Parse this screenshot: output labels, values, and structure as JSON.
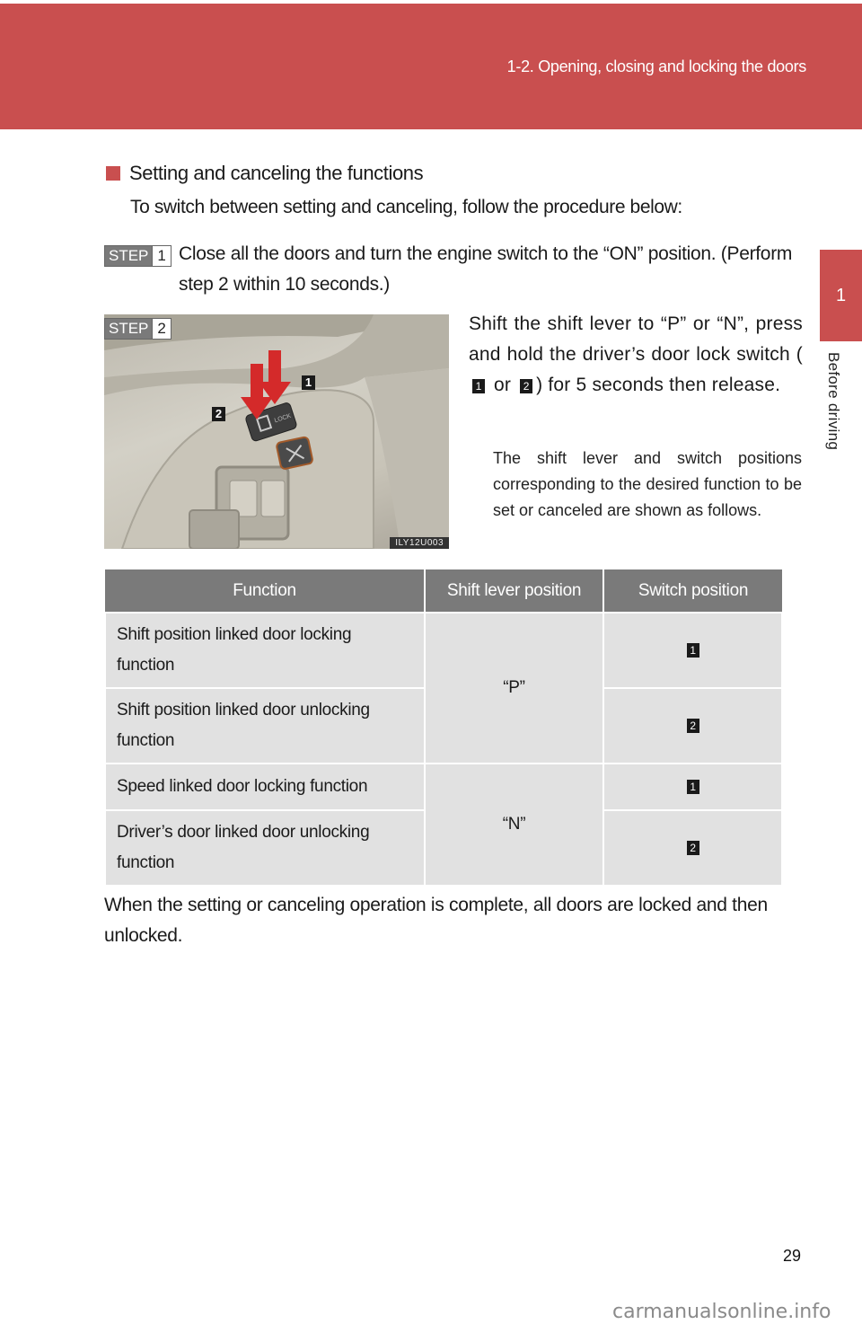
{
  "header": {
    "title": "1-2. Opening, closing and locking the doors",
    "color": "#c94f4f"
  },
  "chapter": {
    "number": "1",
    "label": "Before driving"
  },
  "section": {
    "heading": "Setting and canceling the functions",
    "intro": "To switch between setting and canceling, follow the procedure below:"
  },
  "steps": [
    {
      "word": "STEP",
      "number": "1",
      "text": "Close all the doors and turn the engine switch to the “ON” position. (Perform step 2 within 10 seconds.)"
    },
    {
      "word": "STEP",
      "number": "2",
      "text_before": "Shift the shift lever to “P” or “N”, press and hold the driver’s door lock switch (",
      "callout_a": "1",
      "text_or": " or ",
      "callout_b": "2",
      "text_after": ") for 5 seconds then release.",
      "note": "The shift lever and switch positions corresponding to the desired function to be set or canceled are shown as follows."
    }
  ],
  "photo": {
    "code": "ILY12U003",
    "callout_1": "1",
    "callout_2": "2"
  },
  "table": {
    "headers": [
      "Function",
      "Shift lever position",
      "Switch position"
    ],
    "rows": [
      {
        "function": "Shift position linked door locking function",
        "shift": "“P”",
        "switch": "1"
      },
      {
        "function": "Shift position linked door unlocking function",
        "shift": "“P”",
        "switch": "2"
      },
      {
        "function": "Speed linked door locking function",
        "shift": "“N”",
        "switch": "1"
      },
      {
        "function": "Driver’s door linked door unlocking function",
        "shift": "“N”",
        "switch": "2"
      }
    ]
  },
  "closing": "When the setting or canceling operation is complete, all doors are locked and then unlocked.",
  "page_number": "29",
  "watermark": "carmanualsonline.info"
}
